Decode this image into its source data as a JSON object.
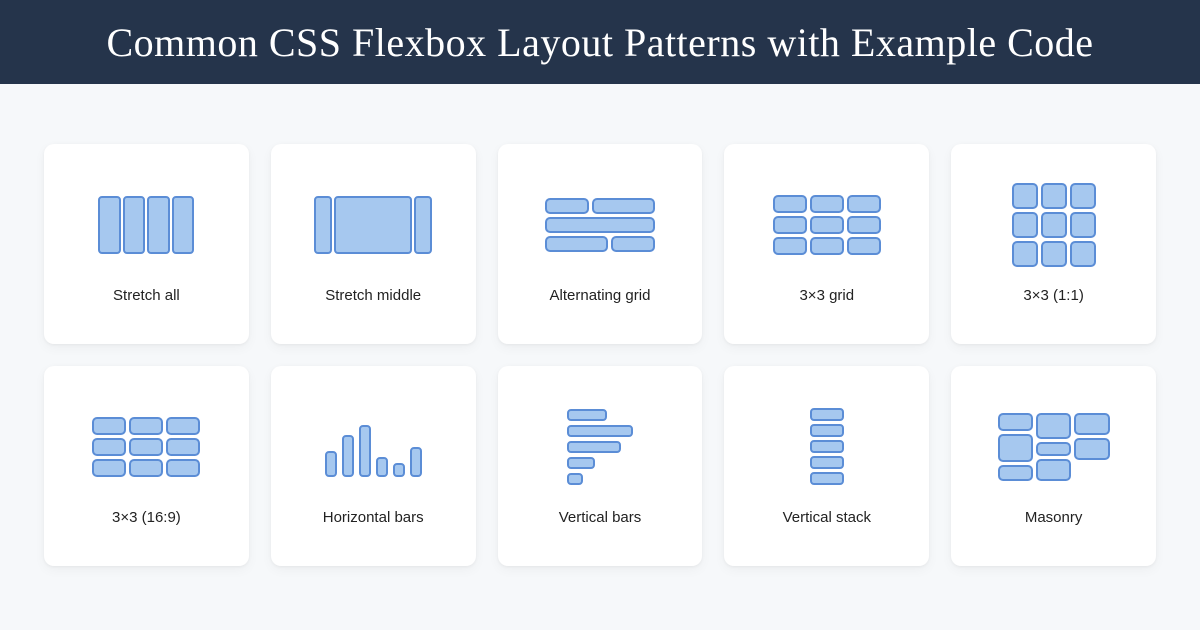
{
  "title": "Common CSS Flexbox Layout Patterns with Example Code",
  "cards": [
    {
      "label": "Stretch all"
    },
    {
      "label": "Stretch middle"
    },
    {
      "label": "Alternating grid"
    },
    {
      "label": "3×3 grid"
    },
    {
      "label": "3×3 (1:1)"
    },
    {
      "label": "3×3 (16:9)"
    },
    {
      "label": "Horizontal bars"
    },
    {
      "label": "Vertical bars"
    },
    {
      "label": "Vertical stack"
    },
    {
      "label": "Masonry"
    }
  ],
  "colors": {
    "header_bg": "#25344b",
    "page_bg": "#f6f8fa",
    "shape_fill": "#a6c8ef",
    "shape_border": "#5b8dd6"
  }
}
